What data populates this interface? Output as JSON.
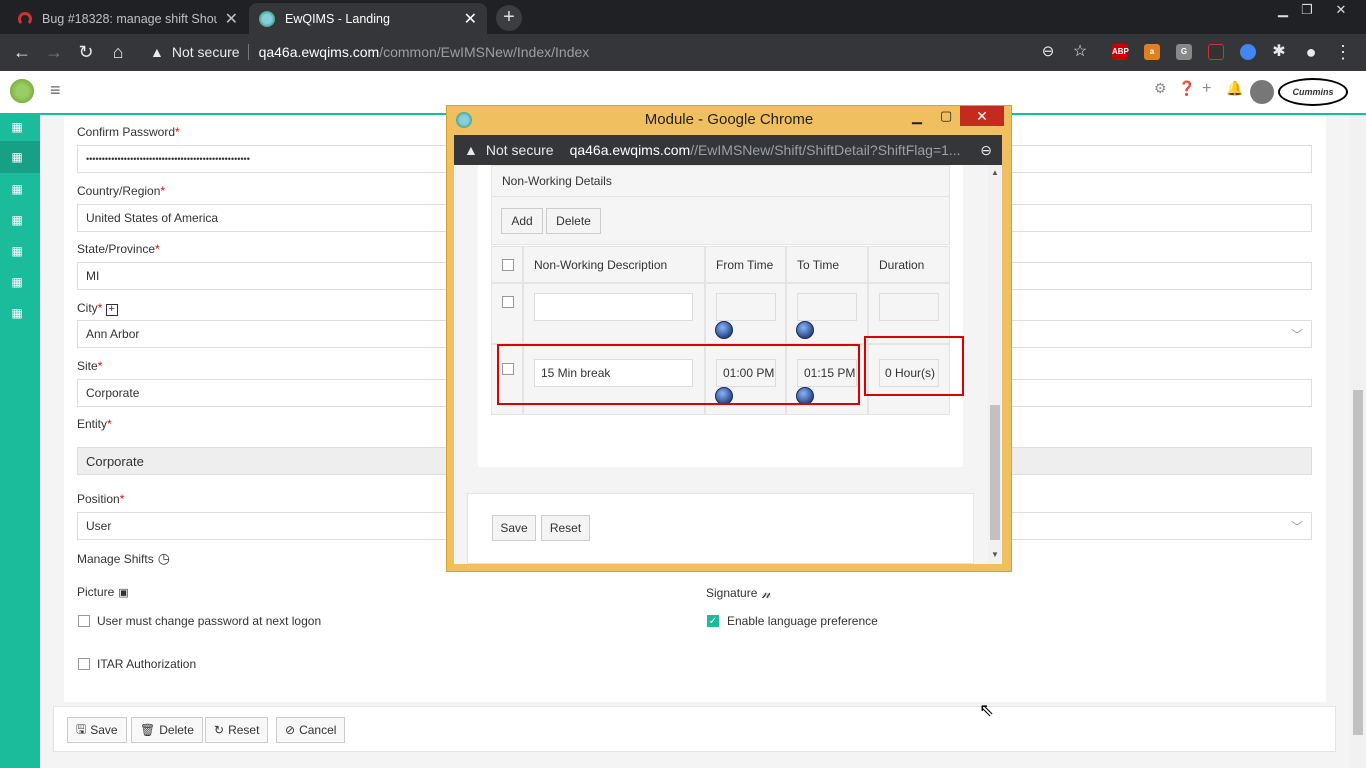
{
  "browser": {
    "tabs": [
      {
        "label": "Bug #18328: manage shift Shoulc"
      },
      {
        "label": "EwQIMS - Landing"
      }
    ],
    "new_tab": "+",
    "security": "Not secure",
    "url_domain": "qa46a.ewqims.com",
    "url_path": "/common/EwIMSNew/Index/Index",
    "extensions": [
      "ABP",
      "G"
    ]
  },
  "form": {
    "confirm_password": {
      "label": "Confirm Password",
      "value": "••••••••••••••••••••••••••••••••••••••••••••••••••••"
    },
    "country": {
      "label": "Country/Region",
      "value": "United States of America"
    },
    "state": {
      "label": "State/Province",
      "value": "MI"
    },
    "city": {
      "label": "City",
      "value": "Ann Arbor"
    },
    "site": {
      "label": "Site",
      "value": "Corporate"
    },
    "entity": {
      "label": "Entity",
      "value": "Corporate"
    },
    "position": {
      "label": "Position",
      "value": "User"
    },
    "manage_shifts": "Manage Shifts",
    "picture": "Picture",
    "signature": "Signature",
    "must_change_password": "User must change password at next logon",
    "enable_language": "Enable language preference",
    "itar": "ITAR Authorization",
    "buttons": {
      "save": "Save",
      "delete": "Delete",
      "reset": "Reset",
      "cancel": "Cancel"
    }
  },
  "popup": {
    "title": "Module - Google Chrome",
    "security": "Not secure",
    "url_domain": "qa46a.ewqims.com",
    "url_path": "//EwIMSNew/Shift/ShiftDetail?ShiftFlag=1...",
    "section_title": "Non-Working Details",
    "add": "Add",
    "delete": "Delete",
    "columns": [
      "Non-Working Description",
      "From Time",
      "To Time",
      "Duration"
    ],
    "row": {
      "description": "15 Min break",
      "from": "01:00 PM",
      "to": "01:15 PM",
      "duration": "0 Hour(s)"
    },
    "save": "Save",
    "reset": "Reset"
  }
}
